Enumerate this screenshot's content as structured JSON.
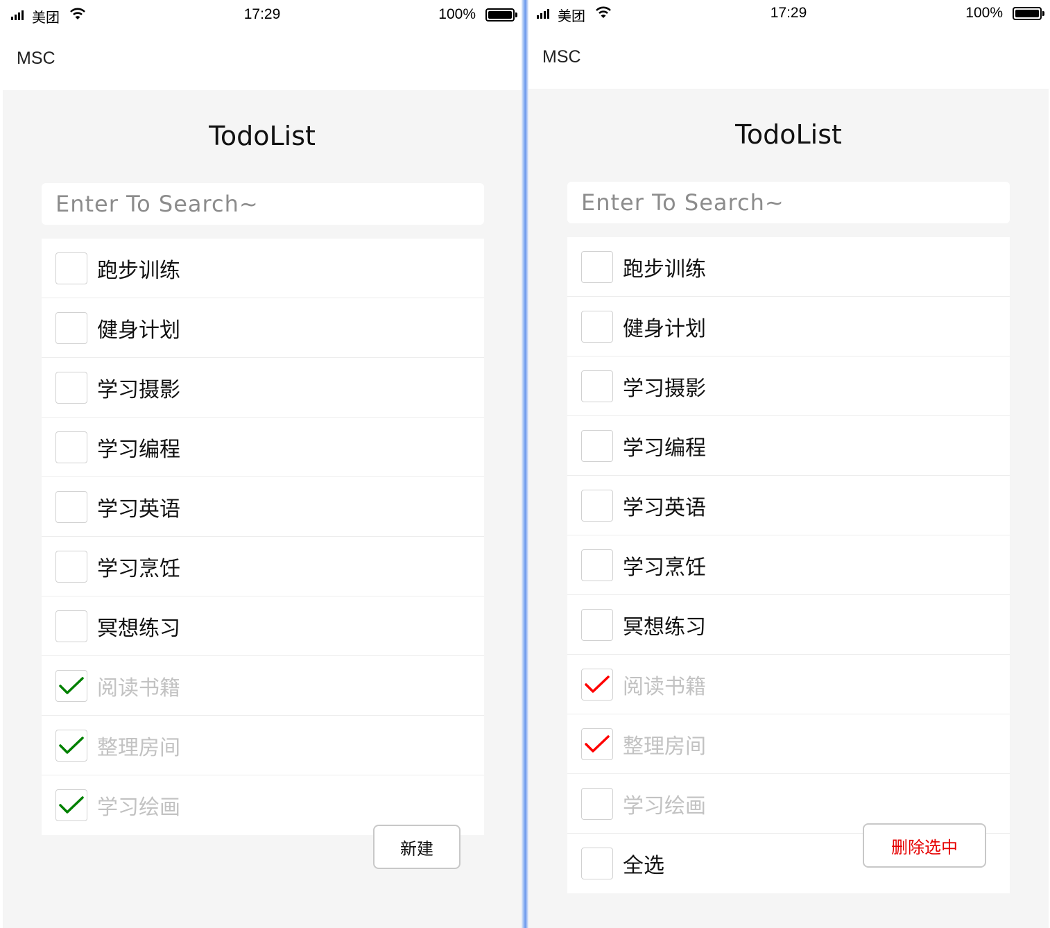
{
  "status_bar": {
    "carrier": "美团",
    "time": "17:29",
    "battery": "100%"
  },
  "nav": {
    "title": "MSC"
  },
  "page": {
    "title": "TodoList",
    "search_placeholder": "Enter To Search~"
  },
  "colors": {
    "check_left": "#008000",
    "check_right": "#ff0000",
    "delete_text": "#e60000"
  },
  "left_screen": {
    "todos": [
      {
        "label": "跑步训练",
        "checked": false
      },
      {
        "label": "健身计划",
        "checked": false
      },
      {
        "label": "学习摄影",
        "checked": false
      },
      {
        "label": "学习编程",
        "checked": false
      },
      {
        "label": "学习英语",
        "checked": false
      },
      {
        "label": "学习烹饪",
        "checked": false
      },
      {
        "label": "冥想练习",
        "checked": false
      },
      {
        "label": "阅读书籍",
        "checked": true
      },
      {
        "label": "整理房间",
        "checked": true
      },
      {
        "label": "学习绘画",
        "checked": true
      }
    ],
    "new_button": "新建"
  },
  "right_screen": {
    "todos": [
      {
        "label": "跑步训练",
        "checked": false
      },
      {
        "label": "健身计划",
        "checked": false
      },
      {
        "label": "学习摄影",
        "checked": false
      },
      {
        "label": "学习编程",
        "checked": false
      },
      {
        "label": "学习英语",
        "checked": false
      },
      {
        "label": "学习烹饪",
        "checked": false
      },
      {
        "label": "冥想练习",
        "checked": false
      },
      {
        "label": "阅读书籍",
        "checked": true
      },
      {
        "label": "整理房间",
        "checked": true
      },
      {
        "label": "学习绘画",
        "checked": false
      }
    ],
    "select_all_label": "全选",
    "delete_button": "删除选中"
  }
}
